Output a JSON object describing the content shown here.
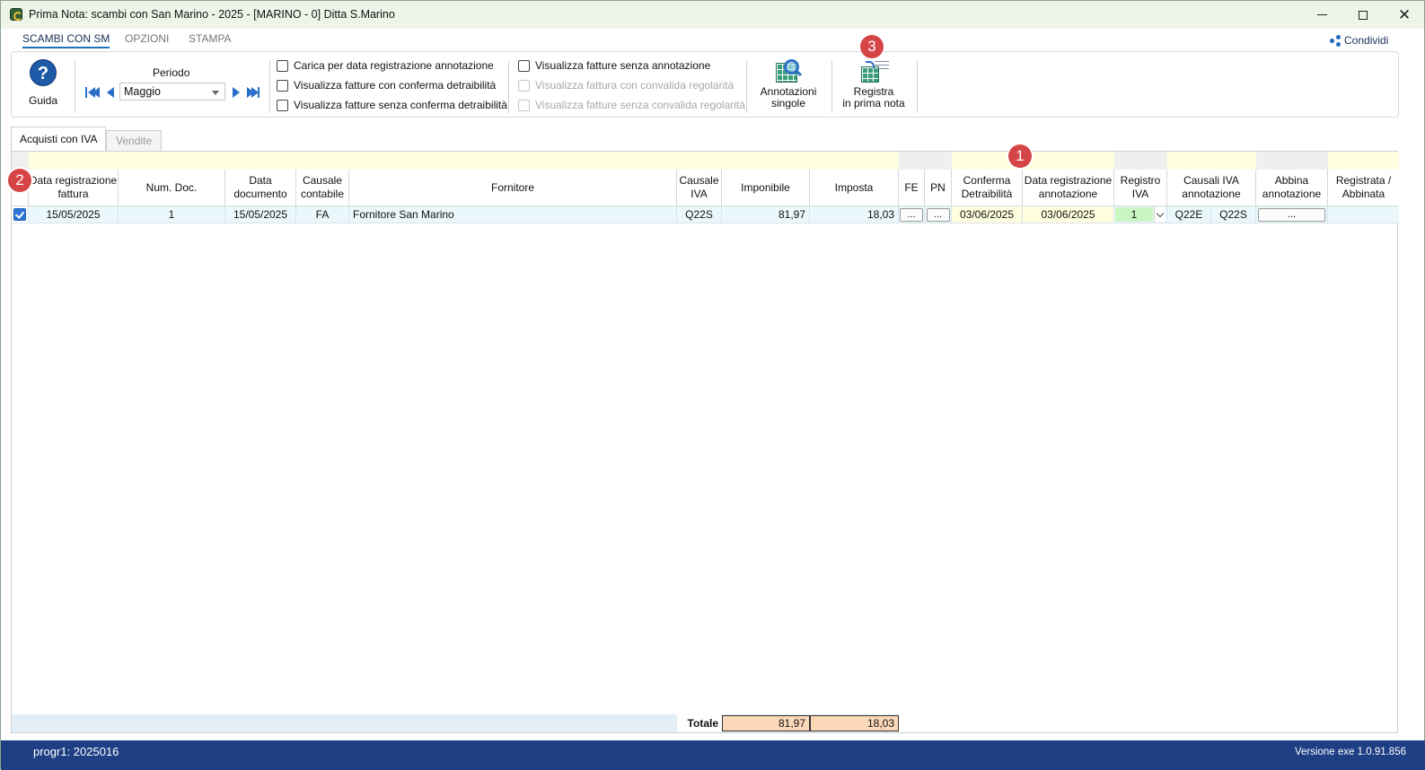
{
  "window": {
    "title": "Prima Nota: scambi con San Marino - 2025 - [MARINO - 0] Ditta S.Marino"
  },
  "ribbon_tabs": [
    {
      "label": "SCAMBI CON SM",
      "active": true
    },
    {
      "label": "OPZIONI",
      "active": false
    },
    {
      "label": "STAMPA",
      "active": false
    }
  ],
  "share_label": "Condividi",
  "toolbar": {
    "guida_label": "Guida",
    "periodo_label": "Periodo",
    "periodo_value": "Maggio",
    "checks_group1": [
      {
        "label": "Carica per data registrazione annotazione",
        "checked": false,
        "enabled": true
      },
      {
        "label": "Visualizza fatture con conferma detraibilità",
        "checked": false,
        "enabled": true
      },
      {
        "label": "Visualizza fatture senza conferma detraibilità",
        "checked": false,
        "enabled": true
      }
    ],
    "checks_group2": [
      {
        "label": "Visualizza fatture senza annotazione",
        "checked": false,
        "enabled": true
      },
      {
        "label": "Visualizza fattura con convalida regolarità",
        "checked": false,
        "enabled": false
      },
      {
        "label": "Visualizza fatture senza convalida regolarità",
        "checked": false,
        "enabled": false
      }
    ],
    "annotazioni_line1": "Annotazioni",
    "annotazioni_line2": "singole",
    "registra_line1": "Registra",
    "registra_line2": "in prima nota"
  },
  "badges": [
    "1",
    "2",
    "3"
  ],
  "content_tabs": [
    {
      "label": "Acquisti con IVA",
      "active": true
    },
    {
      "label": "Vendite",
      "active": false
    }
  ],
  "table": {
    "headers": [
      [
        "Data registrazione",
        "fattura"
      ],
      [
        "Num. Doc."
      ],
      [
        "Data",
        "documento"
      ],
      [
        "Causale",
        "contabile"
      ],
      [
        "Fornitore"
      ],
      [
        "Causale",
        "IVA"
      ],
      [
        "Imponibile"
      ],
      [
        "Imposta"
      ],
      [
        "FE"
      ],
      [
        "PN"
      ],
      [
        "Conferma",
        "Detraibilità"
      ],
      [
        "Data registrazione",
        "annotazione"
      ],
      [
        "Registro",
        "IVA"
      ],
      [
        "Causali IVA",
        "annotazione"
      ],
      [
        "Abbina",
        "annotazione"
      ],
      [
        "Registrata /",
        "Abbinata"
      ]
    ],
    "rows": [
      {
        "selected": true,
        "data_reg_fattura": "15/05/2025",
        "num_doc": "1",
        "data_documento": "15/05/2025",
        "causale_contabile": "FA",
        "fornitore": "Fornitore San Marino",
        "causale_iva": "Q22S",
        "imponibile": "81,97",
        "imposta": "18,03",
        "fe": "...",
        "pn": "...",
        "conferma_detraibilita": "03/06/2025",
        "data_reg_annotazione": "03/06/2025",
        "registro_iva": "1",
        "causale_iva_ann_1": "Q22E",
        "causale_iva_ann_2": "Q22S",
        "abbina": "...",
        "registrata": ""
      }
    ],
    "totals": {
      "label": "Totale",
      "imponibile": "81,97",
      "imposta": "18,03"
    }
  },
  "statusbar": {
    "left": "progr1: 2025016",
    "right": "Versione exe 1.0.91.856"
  },
  "colors": {
    "title_bg": "#eef4e8",
    "header_band": "#ffffe0",
    "row_bg": "#eaf8fb",
    "total_cell": "#fbd9b8",
    "registro_cell": "#c9f5c2",
    "status_bg": "#1e3f84",
    "badge": "#d64545"
  }
}
